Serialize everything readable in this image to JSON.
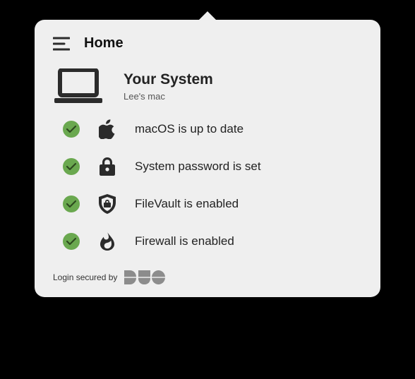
{
  "header": {
    "title": "Home"
  },
  "system": {
    "title": "Your System",
    "subtitle": "Lee's mac"
  },
  "items": [
    {
      "label": "macOS is up to date"
    },
    {
      "label": "System password is set"
    },
    {
      "label": "FileVault is enabled"
    },
    {
      "label": "Firewall is enabled"
    }
  ],
  "footer": {
    "secured": "Login secured by"
  }
}
